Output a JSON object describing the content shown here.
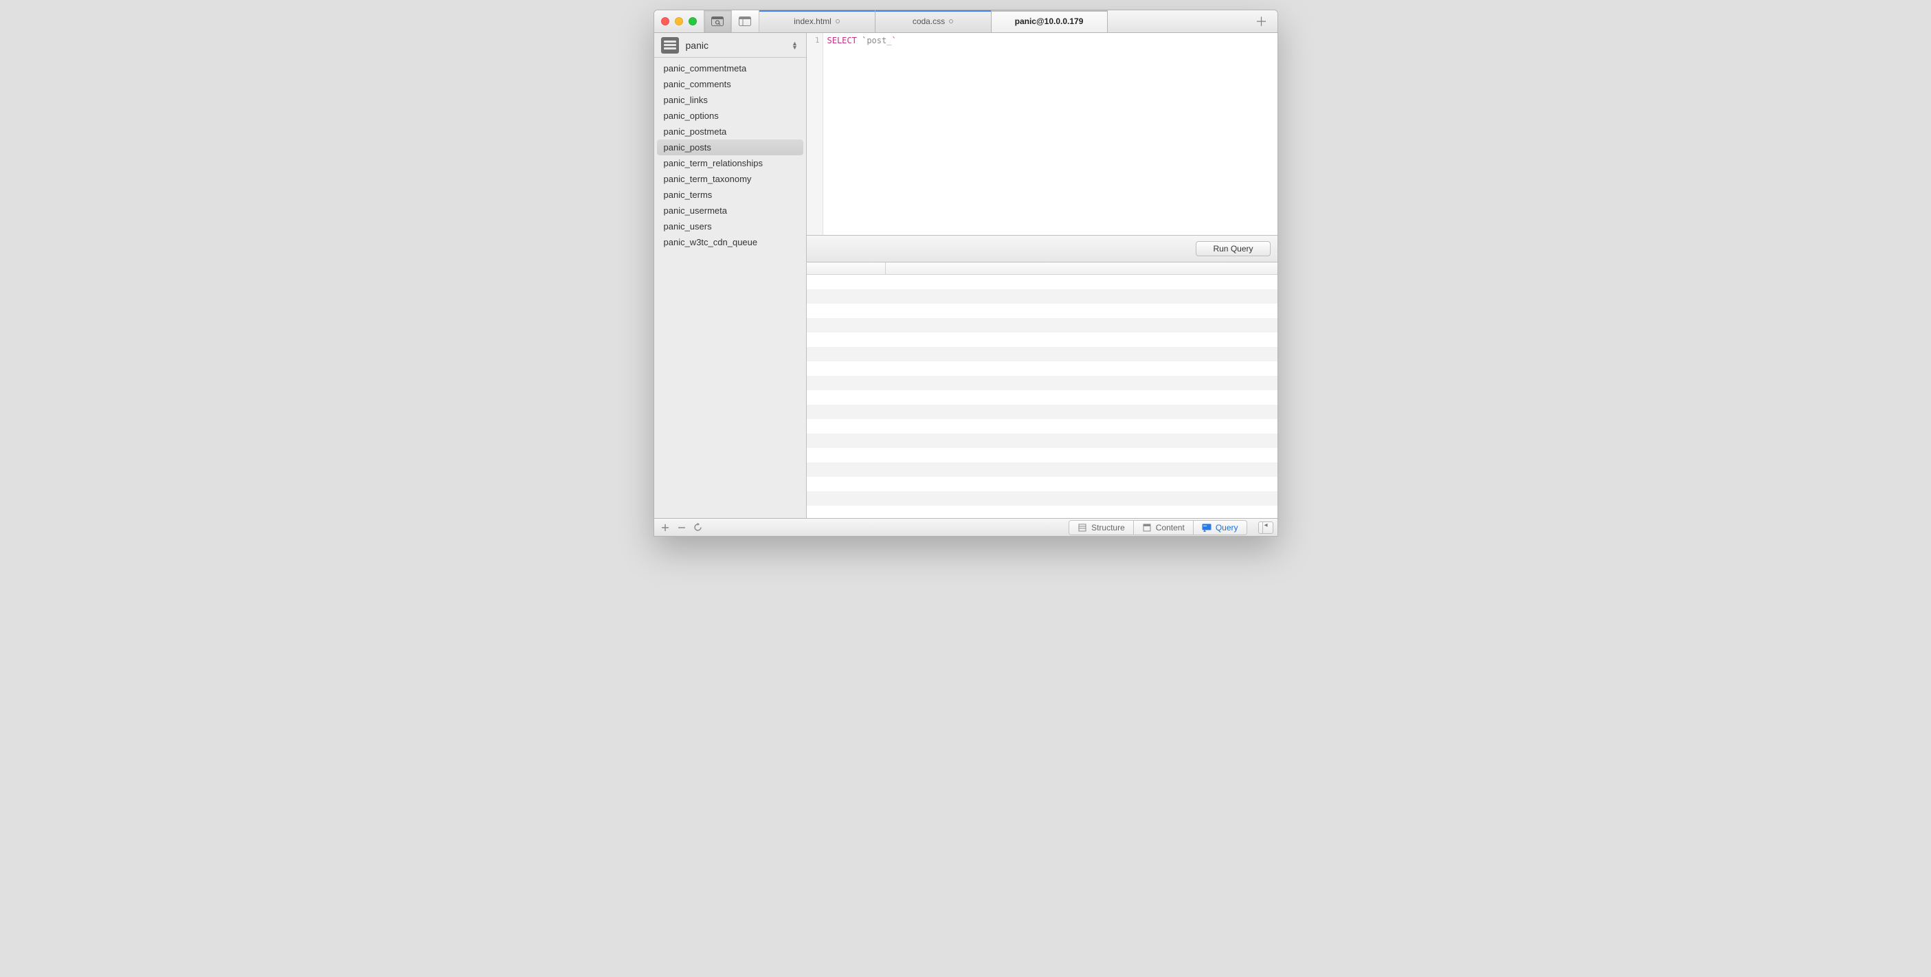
{
  "tabs": [
    {
      "label": "index.html",
      "modified": true,
      "active": false
    },
    {
      "label": "coda.css",
      "modified": true,
      "active": false
    },
    {
      "label": "panic@10.0.0.179",
      "modified": false,
      "active": true
    }
  ],
  "sidebar": {
    "database": "panic",
    "tables": [
      "panic_commentmeta",
      "panic_comments",
      "panic_links",
      "panic_options",
      "panic_postmeta",
      "panic_posts",
      "panic_term_relationships",
      "panic_term_taxonomy",
      "panic_terms",
      "panic_usermeta",
      "panic_users",
      "panic_w3tc_cdn_queue"
    ],
    "selected_index": 5
  },
  "editor": {
    "line_numbers": [
      "1"
    ],
    "tokens": [
      {
        "text": "SELECT",
        "cls": "kw"
      },
      {
        "text": " ",
        "cls": ""
      },
      {
        "text": "`",
        "cls": "str"
      },
      {
        "text": "post_",
        "cls": "ident"
      },
      {
        "text": "`",
        "cls": "str"
      }
    ]
  },
  "run_button": "Run Query",
  "results_header_widths": [
    115
  ],
  "footer": {
    "structure": "Structure",
    "content": "Content",
    "query": "Query"
  }
}
